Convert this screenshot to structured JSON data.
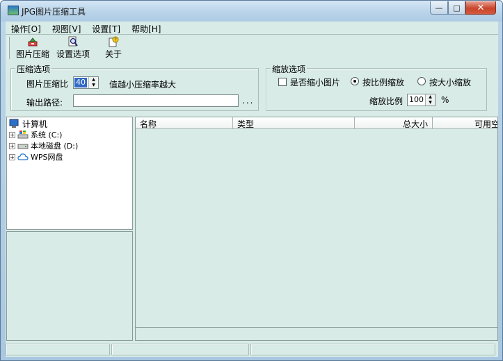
{
  "window": {
    "title": "JPG图片压缩工具",
    "minimize_glyph": "—",
    "maximize_glyph": "□",
    "close_glyph": "✕"
  },
  "menu": [
    {
      "label": "操作[O]"
    },
    {
      "label": "视图[V]"
    },
    {
      "label": "设置[T]"
    },
    {
      "label": "帮助[H]"
    }
  ],
  "toolbar": [
    {
      "label": "图片压缩",
      "icon": "compress-icon"
    },
    {
      "label": "设置选项",
      "icon": "settings-magnifier-icon"
    },
    {
      "label": "关于",
      "icon": "about-icon"
    }
  ],
  "compress_options": {
    "group_title": "压缩选项",
    "ratio_label": "图片压缩比",
    "ratio_value": "40",
    "ratio_hint": "值越小压缩率越大",
    "output_label": "输出路径:",
    "output_value": "",
    "browse_label": "..."
  },
  "scale_options": {
    "group_title": "缩放选项",
    "shrink_checkbox_label": "是否缩小图片",
    "shrink_checked": false,
    "radio_ratio_label": "按比例缩放",
    "radio_size_label": "按大小缩放",
    "selected_radio": "ratio",
    "scale_label": "缩放比例",
    "scale_value": "100",
    "scale_unit": "%"
  },
  "tree": {
    "root": "计算机",
    "items": [
      {
        "label": "系统 (C:)",
        "icon": "system-drive-icon"
      },
      {
        "label": "本地磁盘 (D:)",
        "icon": "local-disk-icon"
      },
      {
        "label": "WPS网盘",
        "icon": "cloud-drive-icon"
      }
    ]
  },
  "list": {
    "columns": [
      "名称",
      "类型",
      "总大小",
      "可用空"
    ]
  },
  "colors": {
    "client_bg": "#d8ebe6",
    "titlebar": "#bcd5ea",
    "close_button": "#c8462c",
    "selection": "#3069c6"
  }
}
